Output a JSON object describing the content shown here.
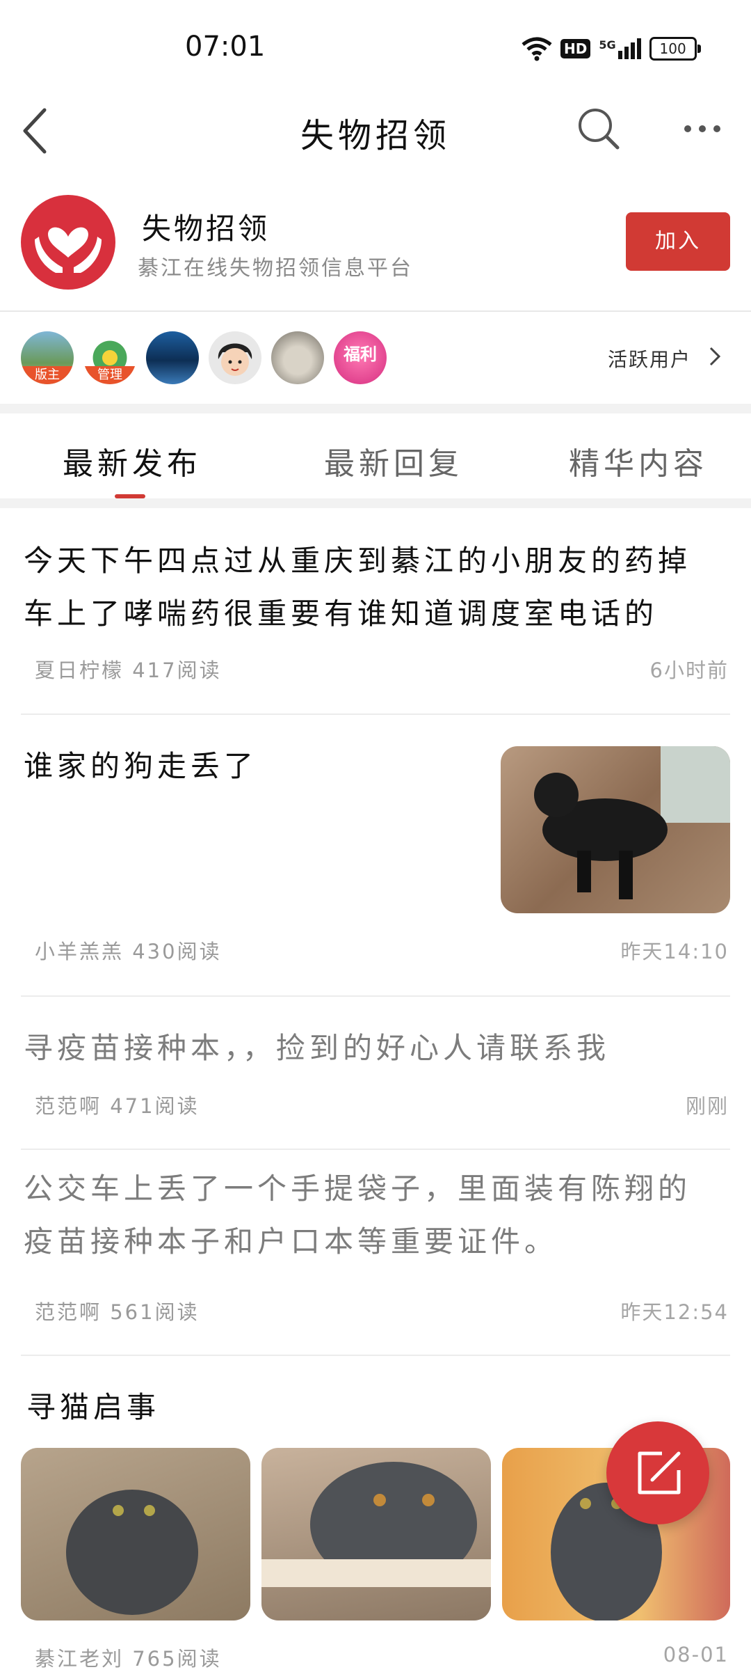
{
  "status": {
    "time": "07:01",
    "hd": "HD",
    "net": "5G",
    "battery": "100"
  },
  "nav": {
    "title": "失物招领"
  },
  "group": {
    "name": "失物招领",
    "description": "綦江在线失物招领信息平台",
    "join_label": "加入"
  },
  "members": {
    "tags": [
      "版主",
      "管理"
    ],
    "welfare_label": "福利",
    "active_users_label": "活跃用户"
  },
  "tabs": [
    {
      "label": "最新发布",
      "active": true
    },
    {
      "label": "最新回复",
      "active": false
    },
    {
      "label": "精华内容",
      "active": false
    }
  ],
  "posts": [
    {
      "title_line1": "今天下午四点过从重庆到綦江的小朋友的药掉",
      "title_line2": "车上了哮喘药很重要有谁知道调度室电话的",
      "author_reads": "夏日柠檬 417阅读",
      "time": "6小时前"
    },
    {
      "title": "谁家的狗走丢了",
      "author_reads": "小羊羔羔 430阅读",
      "time": "昨天14:10"
    },
    {
      "title": "寻疫苗接种本，，捡到的好心人请联系我",
      "author_reads": "范范啊 471阅读",
      "time": "刚刚"
    },
    {
      "title_line1": "公交车上丢了一个手提袋子，里面装有陈翔的",
      "title_line2": "疫苗接种本子和户口本等重要证件。",
      "author_reads": "范范啊 561阅读",
      "time": "昨天12:54"
    },
    {
      "title": "寻猫启事",
      "author_reads": "綦江老刘 765阅读",
      "time": "08-01"
    }
  ],
  "colors": {
    "accent": "#d13a34",
    "fab": "#d8383a",
    "logo": "#d8303d"
  }
}
